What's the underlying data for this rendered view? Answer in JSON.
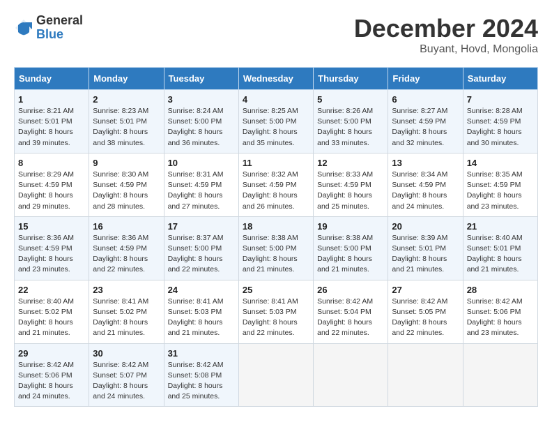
{
  "header": {
    "logo_general": "General",
    "logo_blue": "Blue",
    "title": "December 2024",
    "location": "Buyant, Hovd, Mongolia"
  },
  "days_of_week": [
    "Sunday",
    "Monday",
    "Tuesday",
    "Wednesday",
    "Thursday",
    "Friday",
    "Saturday"
  ],
  "weeks": [
    [
      {
        "day": "1",
        "sunrise": "Sunrise: 8:21 AM",
        "sunset": "Sunset: 5:01 PM",
        "daylight": "Daylight: 8 hours and 39 minutes."
      },
      {
        "day": "2",
        "sunrise": "Sunrise: 8:23 AM",
        "sunset": "Sunset: 5:01 PM",
        "daylight": "Daylight: 8 hours and 38 minutes."
      },
      {
        "day": "3",
        "sunrise": "Sunrise: 8:24 AM",
        "sunset": "Sunset: 5:00 PM",
        "daylight": "Daylight: 8 hours and 36 minutes."
      },
      {
        "day": "4",
        "sunrise": "Sunrise: 8:25 AM",
        "sunset": "Sunset: 5:00 PM",
        "daylight": "Daylight: 8 hours and 35 minutes."
      },
      {
        "day": "5",
        "sunrise": "Sunrise: 8:26 AM",
        "sunset": "Sunset: 5:00 PM",
        "daylight": "Daylight: 8 hours and 33 minutes."
      },
      {
        "day": "6",
        "sunrise": "Sunrise: 8:27 AM",
        "sunset": "Sunset: 4:59 PM",
        "daylight": "Daylight: 8 hours and 32 minutes."
      },
      {
        "day": "7",
        "sunrise": "Sunrise: 8:28 AM",
        "sunset": "Sunset: 4:59 PM",
        "daylight": "Daylight: 8 hours and 30 minutes."
      }
    ],
    [
      {
        "day": "8",
        "sunrise": "Sunrise: 8:29 AM",
        "sunset": "Sunset: 4:59 PM",
        "daylight": "Daylight: 8 hours and 29 minutes."
      },
      {
        "day": "9",
        "sunrise": "Sunrise: 8:30 AM",
        "sunset": "Sunset: 4:59 PM",
        "daylight": "Daylight: 8 hours and 28 minutes."
      },
      {
        "day": "10",
        "sunrise": "Sunrise: 8:31 AM",
        "sunset": "Sunset: 4:59 PM",
        "daylight": "Daylight: 8 hours and 27 minutes."
      },
      {
        "day": "11",
        "sunrise": "Sunrise: 8:32 AM",
        "sunset": "Sunset: 4:59 PM",
        "daylight": "Daylight: 8 hours and 26 minutes."
      },
      {
        "day": "12",
        "sunrise": "Sunrise: 8:33 AM",
        "sunset": "Sunset: 4:59 PM",
        "daylight": "Daylight: 8 hours and 25 minutes."
      },
      {
        "day": "13",
        "sunrise": "Sunrise: 8:34 AM",
        "sunset": "Sunset: 4:59 PM",
        "daylight": "Daylight: 8 hours and 24 minutes."
      },
      {
        "day": "14",
        "sunrise": "Sunrise: 8:35 AM",
        "sunset": "Sunset: 4:59 PM",
        "daylight": "Daylight: 8 hours and 23 minutes."
      }
    ],
    [
      {
        "day": "15",
        "sunrise": "Sunrise: 8:36 AM",
        "sunset": "Sunset: 4:59 PM",
        "daylight": "Daylight: 8 hours and 23 minutes."
      },
      {
        "day": "16",
        "sunrise": "Sunrise: 8:36 AM",
        "sunset": "Sunset: 4:59 PM",
        "daylight": "Daylight: 8 hours and 22 minutes."
      },
      {
        "day": "17",
        "sunrise": "Sunrise: 8:37 AM",
        "sunset": "Sunset: 5:00 PM",
        "daylight": "Daylight: 8 hours and 22 minutes."
      },
      {
        "day": "18",
        "sunrise": "Sunrise: 8:38 AM",
        "sunset": "Sunset: 5:00 PM",
        "daylight": "Daylight: 8 hours and 21 minutes."
      },
      {
        "day": "19",
        "sunrise": "Sunrise: 8:38 AM",
        "sunset": "Sunset: 5:00 PM",
        "daylight": "Daylight: 8 hours and 21 minutes."
      },
      {
        "day": "20",
        "sunrise": "Sunrise: 8:39 AM",
        "sunset": "Sunset: 5:01 PM",
        "daylight": "Daylight: 8 hours and 21 minutes."
      },
      {
        "day": "21",
        "sunrise": "Sunrise: 8:40 AM",
        "sunset": "Sunset: 5:01 PM",
        "daylight": "Daylight: 8 hours and 21 minutes."
      }
    ],
    [
      {
        "day": "22",
        "sunrise": "Sunrise: 8:40 AM",
        "sunset": "Sunset: 5:02 PM",
        "daylight": "Daylight: 8 hours and 21 minutes."
      },
      {
        "day": "23",
        "sunrise": "Sunrise: 8:41 AM",
        "sunset": "Sunset: 5:02 PM",
        "daylight": "Daylight: 8 hours and 21 minutes."
      },
      {
        "day": "24",
        "sunrise": "Sunrise: 8:41 AM",
        "sunset": "Sunset: 5:03 PM",
        "daylight": "Daylight: 8 hours and 21 minutes."
      },
      {
        "day": "25",
        "sunrise": "Sunrise: 8:41 AM",
        "sunset": "Sunset: 5:03 PM",
        "daylight": "Daylight: 8 hours and 22 minutes."
      },
      {
        "day": "26",
        "sunrise": "Sunrise: 8:42 AM",
        "sunset": "Sunset: 5:04 PM",
        "daylight": "Daylight: 8 hours and 22 minutes."
      },
      {
        "day": "27",
        "sunrise": "Sunrise: 8:42 AM",
        "sunset": "Sunset: 5:05 PM",
        "daylight": "Daylight: 8 hours and 22 minutes."
      },
      {
        "day": "28",
        "sunrise": "Sunrise: 8:42 AM",
        "sunset": "Sunset: 5:06 PM",
        "daylight": "Daylight: 8 hours and 23 minutes."
      }
    ],
    [
      {
        "day": "29",
        "sunrise": "Sunrise: 8:42 AM",
        "sunset": "Sunset: 5:06 PM",
        "daylight": "Daylight: 8 hours and 24 minutes."
      },
      {
        "day": "30",
        "sunrise": "Sunrise: 8:42 AM",
        "sunset": "Sunset: 5:07 PM",
        "daylight": "Daylight: 8 hours and 24 minutes."
      },
      {
        "day": "31",
        "sunrise": "Sunrise: 8:42 AM",
        "sunset": "Sunset: 5:08 PM",
        "daylight": "Daylight: 8 hours and 25 minutes."
      },
      null,
      null,
      null,
      null
    ]
  ]
}
